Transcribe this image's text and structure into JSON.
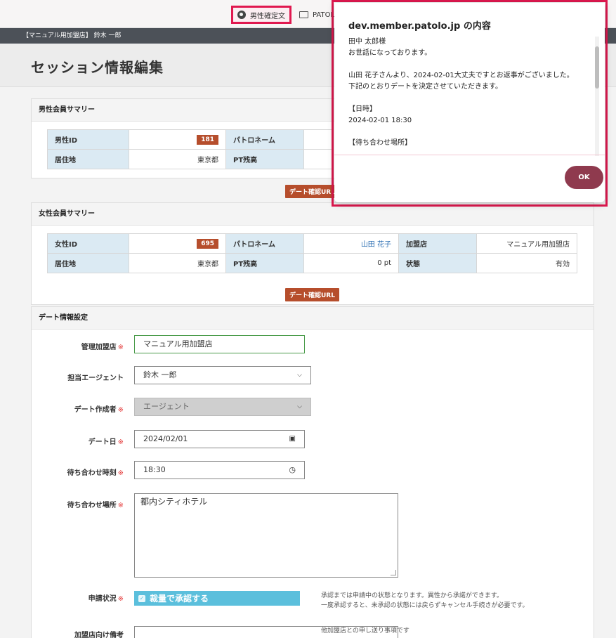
{
  "bookmarks": [
    {
      "label": "男性確定文",
      "icon": "globe-icon"
    },
    {
      "label": "PATOL",
      "icon": "folder-icon"
    }
  ],
  "header": {
    "user_label": "【マニュアル用加盟店】 鈴木 一郎"
  },
  "page": {
    "title": "セッション情報編集"
  },
  "male_summary": {
    "title": "男性会員サマリー",
    "id_label": "男性ID",
    "id_value": "181",
    "patoname_label": "パトロネーム",
    "residence_label": "居住地",
    "residence_value": "東京都",
    "pt_label": "PT残高",
    "url_button": "デート確認URL"
  },
  "female_summary": {
    "title": "女性会員サマリー",
    "id_label": "女性ID",
    "id_value": "695",
    "patoname_label": "パトロネーム",
    "patoname_value": "山田 花子",
    "store_label": "加盟店",
    "store_value": "マニュアル用加盟店",
    "residence_label": "居住地",
    "residence_value": "東京都",
    "pt_label": "PT残高",
    "pt_value": "0 pt",
    "status_label": "状態",
    "status_value": "有効",
    "url_button": "デート確認URL"
  },
  "date_settings": {
    "title": "デート情報設定",
    "required_mark": "※",
    "store_label": "管理加盟店",
    "store_value": "マニュアル用加盟店",
    "agent_label": "担当エージェント",
    "agent_value": "鈴木 一郎",
    "creator_label": "デート作成者",
    "creator_value": "エージェント",
    "date_label": "デート日",
    "date_value": "2024/02/01",
    "time_label": "待ち合わせ時刻",
    "time_value": "18:30",
    "place_label": "待ち合わせ場所",
    "place_value": "都内シティホテル",
    "status_label": "申請状況",
    "status_checkbox": "裁量で承認する",
    "status_note_1": "承認までは申請中の状態となります。異性から承諾ができます。",
    "status_note_2": "一度承認すると、未承認の状態には戻らずキャンセル手続きが必要です。",
    "remarks_label": "加盟店向け備考",
    "remarks_note": "他加盟店との申し送り事項です"
  },
  "dialog": {
    "title": "dev.member.patolo.jp の内容",
    "lines": [
      "田中 太郎様",
      "お世話になっております。",
      "",
      "山田 花子さんより、2024-02-01大丈夫ですとお返事がございました。",
      "下記のとおりデートを決定させていただきます。",
      "",
      "【日時】",
      "2024-02-01 18:30",
      "",
      "【待ち合わせ場所】"
    ],
    "ok_label": "OK"
  },
  "colors": {
    "accent": "#e0184f",
    "ok_button": "#8f3a4e",
    "badge": "#b64e2c",
    "label_bg": "#dbeaf3",
    "approve": "#5bbfdc"
  }
}
